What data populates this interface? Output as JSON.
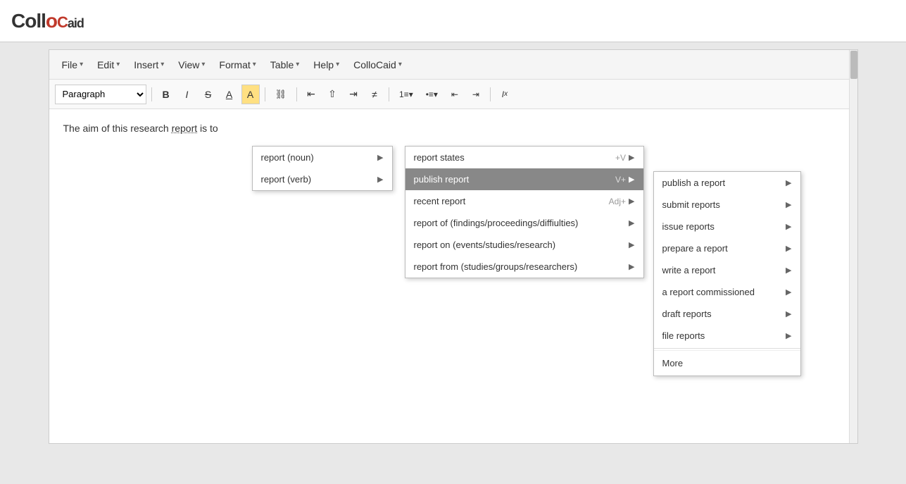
{
  "logo": {
    "text_coll": "Collo",
    "text_c": "C",
    "text_aid": "aid"
  },
  "menu_bar": {
    "items": [
      {
        "label": "File",
        "id": "file"
      },
      {
        "label": "Edit",
        "id": "edit"
      },
      {
        "label": "Insert",
        "id": "insert"
      },
      {
        "label": "View",
        "id": "view"
      },
      {
        "label": "Format",
        "id": "format"
      },
      {
        "label": "Table",
        "id": "table"
      },
      {
        "label": "Help",
        "id": "help"
      },
      {
        "label": "ColloCaid",
        "id": "collocaid"
      }
    ]
  },
  "toolbar": {
    "paragraph_label": "Paragraph",
    "buttons": [
      {
        "id": "bold",
        "symbol": "B",
        "tooltip": "Bold"
      },
      {
        "id": "italic",
        "symbol": "I",
        "tooltip": "Italic"
      },
      {
        "id": "strikethrough",
        "symbol": "S",
        "tooltip": "Strikethrough"
      },
      {
        "id": "underline",
        "symbol": "A",
        "tooltip": "Font color"
      },
      {
        "id": "highlight",
        "symbol": "A",
        "tooltip": "Highlight"
      },
      {
        "id": "link",
        "symbol": "🔗",
        "tooltip": "Link"
      },
      {
        "id": "align-left",
        "symbol": "≡",
        "tooltip": "Align left"
      },
      {
        "id": "align-center",
        "symbol": "≡",
        "tooltip": "Align center"
      },
      {
        "id": "align-right",
        "symbol": "≡",
        "tooltip": "Align right"
      },
      {
        "id": "align-justify",
        "symbol": "≡",
        "tooltip": "Justify"
      },
      {
        "id": "ordered-list",
        "symbol": "≡",
        "tooltip": "Ordered list"
      },
      {
        "id": "unordered-list",
        "symbol": "≡",
        "tooltip": "Unordered list"
      },
      {
        "id": "outdent",
        "symbol": "≡",
        "tooltip": "Outdent"
      },
      {
        "id": "indent",
        "symbol": "≡",
        "tooltip": "Indent"
      },
      {
        "id": "clear-format",
        "symbol": "Ix",
        "tooltip": "Clear formatting"
      }
    ]
  },
  "editor": {
    "text_before": "The aim of this research ",
    "highlighted_word": "report",
    "text_after": " is to"
  },
  "ctx_menu_1": {
    "items": [
      {
        "id": "report-noun",
        "label": "report (noun)",
        "has_arrow": true,
        "highlighted": false
      },
      {
        "id": "report-verb",
        "label": "report (verb)",
        "has_arrow": true,
        "highlighted": false
      }
    ]
  },
  "ctx_menu_2": {
    "items": [
      {
        "id": "report-states",
        "label": "report states",
        "shortcut": "+V",
        "has_arrow": true,
        "highlighted": false
      },
      {
        "id": "publish-report",
        "label": "publish report",
        "shortcut": "V+",
        "has_arrow": true,
        "highlighted": true
      },
      {
        "id": "recent-report",
        "label": "recent report",
        "shortcut": "Adj+",
        "has_arrow": true,
        "highlighted": false
      },
      {
        "id": "report-of",
        "label": "report of (findings/proceedings/diffiulties)",
        "shortcut": "",
        "has_arrow": true,
        "highlighted": false
      },
      {
        "id": "report-on",
        "label": "report on (events/studies/research)",
        "shortcut": "",
        "has_arrow": true,
        "highlighted": false
      },
      {
        "id": "report-from",
        "label": "report from (studies/groups/researchers)",
        "shortcut": "",
        "has_arrow": true,
        "highlighted": false
      }
    ]
  },
  "ctx_menu_3": {
    "items": [
      {
        "id": "publish-a-report",
        "label": "publish a report",
        "has_arrow": true
      },
      {
        "id": "submit-reports",
        "label": "submit reports",
        "has_arrow": true
      },
      {
        "id": "issue-reports",
        "label": "issue reports",
        "has_arrow": true
      },
      {
        "id": "prepare-a-report",
        "label": "prepare a report",
        "has_arrow": true
      },
      {
        "id": "write-a-report",
        "label": "write a report",
        "has_arrow": true
      },
      {
        "id": "a-report-commissioned",
        "label": "a report commissioned",
        "has_arrow": true
      },
      {
        "id": "draft-reports",
        "label": "draft reports",
        "has_arrow": true
      },
      {
        "id": "file-reports",
        "label": "file reports",
        "has_arrow": true
      }
    ],
    "more_label": "More"
  }
}
